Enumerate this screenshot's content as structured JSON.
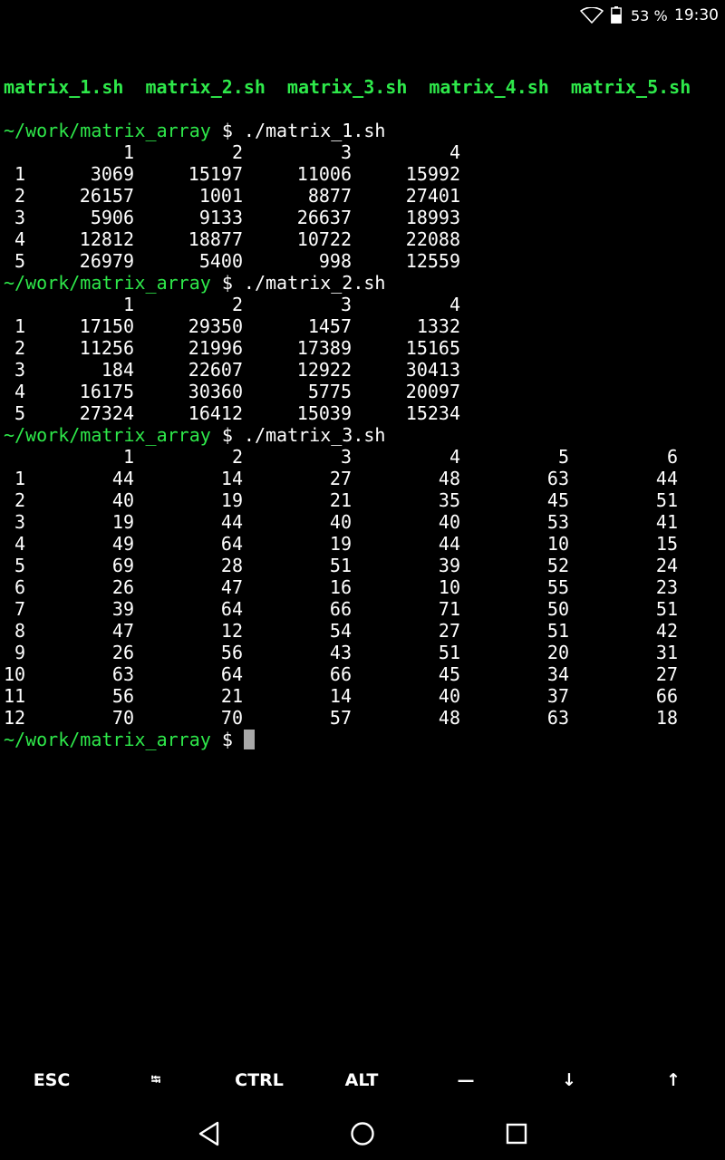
{
  "status_bar": {
    "battery_percent": "53 %",
    "time": "19:30"
  },
  "terminal": {
    "files": [
      "matrix_1.sh",
      "matrix_2.sh",
      "matrix_3.sh",
      "matrix_4.sh",
      "matrix_5.sh"
    ],
    "prompt_path": "~/work/matrix_array",
    "prompt_symbol": "$",
    "blocks": [
      {
        "command": "./matrix_1.sh",
        "columns": [
          "1",
          "2",
          "3",
          "4"
        ],
        "rows": [
          {
            "label": "1",
            "values": [
              "3069",
              "15197",
              "11006",
              "15992"
            ]
          },
          {
            "label": "2",
            "values": [
              "26157",
              "1001",
              "8877",
              "27401"
            ]
          },
          {
            "label": "3",
            "values": [
              "5906",
              "9133",
              "26637",
              "18993"
            ]
          },
          {
            "label": "4",
            "values": [
              "12812",
              "18877",
              "10722",
              "22088"
            ]
          },
          {
            "label": "5",
            "values": [
              "26979",
              "5400",
              "998",
              "12559"
            ]
          }
        ]
      },
      {
        "command": "./matrix_2.sh",
        "columns": [
          "1",
          "2",
          "3",
          "4"
        ],
        "rows": [
          {
            "label": "1",
            "values": [
              "17150",
              "29350",
              "1457",
              "1332"
            ]
          },
          {
            "label": "2",
            "values": [
              "11256",
              "21996",
              "17389",
              "15165"
            ]
          },
          {
            "label": "3",
            "values": [
              "184",
              "22607",
              "12922",
              "30413"
            ]
          },
          {
            "label": "4",
            "values": [
              "16175",
              "30360",
              "5775",
              "20097"
            ]
          },
          {
            "label": "5",
            "values": [
              "27324",
              "16412",
              "15039",
              "15234"
            ]
          }
        ]
      },
      {
        "command": "./matrix_3.sh",
        "columns": [
          "1",
          "2",
          "3",
          "4",
          "5",
          "6"
        ],
        "rows": [
          {
            "label": "1",
            "values": [
              "44",
              "14",
              "27",
              "48",
              "63",
              "44"
            ]
          },
          {
            "label": "2",
            "values": [
              "40",
              "19",
              "21",
              "35",
              "45",
              "51"
            ]
          },
          {
            "label": "3",
            "values": [
              "19",
              "44",
              "40",
              "40",
              "53",
              "41"
            ]
          },
          {
            "label": "4",
            "values": [
              "49",
              "64",
              "19",
              "44",
              "10",
              "15"
            ]
          },
          {
            "label": "5",
            "values": [
              "69",
              "28",
              "51",
              "39",
              "52",
              "24"
            ]
          },
          {
            "label": "6",
            "values": [
              "26",
              "47",
              "16",
              "10",
              "55",
              "23"
            ]
          },
          {
            "label": "7",
            "values": [
              "39",
              "64",
              "66",
              "71",
              "50",
              "51"
            ]
          },
          {
            "label": "8",
            "values": [
              "47",
              "12",
              "54",
              "27",
              "51",
              "42"
            ]
          },
          {
            "label": "9",
            "values": [
              "26",
              "56",
              "43",
              "51",
              "20",
              "31"
            ]
          },
          {
            "label": "10",
            "values": [
              "63",
              "64",
              "66",
              "45",
              "34",
              "27"
            ]
          },
          {
            "label": "11",
            "values": [
              "56",
              "21",
              "14",
              "40",
              "37",
              "66"
            ]
          },
          {
            "label": "12",
            "values": [
              "70",
              "70",
              "57",
              "48",
              "63",
              "18"
            ]
          }
        ]
      }
    ]
  },
  "extra_keys": [
    "ESC",
    "⭾",
    "CTRL",
    "ALT",
    "—",
    "↓",
    "↑"
  ],
  "colors": {
    "prompt_green": "#2ee84a",
    "background": "#000000",
    "cursor": "#a8a8a8"
  },
  "icons": {
    "wifi": "wifi-outline-icon",
    "battery": "battery-icon",
    "back": "back-triangle-icon",
    "home": "home-circle-icon",
    "recents": "recents-square-icon"
  }
}
